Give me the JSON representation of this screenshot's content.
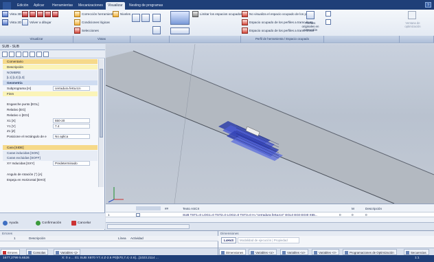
{
  "menu": {
    "tabs": [
      "Edición",
      "Aplicar",
      "Herramientas",
      "Mecanizaciones",
      "Visualizar",
      "Nesting de programas"
    ],
    "active": "Visualizar",
    "help_icon": "help-icon"
  },
  "ribbon": {
    "vista3d": "Vista 3D",
    "vista2d": "Vista 2D",
    "volver_dibujar": "Volver a dibujar",
    "correccion": "Corrección herramienta",
    "niveles": "Niveles",
    "condiciones": "Condiciones lógicas",
    "selecciones": "Selecciones",
    "limitar": "Limitar los espacios ocupados 3D",
    "no_visualiza": "No visualiza el espacio ocupado de los perfiles",
    "lleno": "Espacio ocupado de los perfiles a tramo lleno",
    "lineal": "Espacio ocupado de los perfiles a tramo lineal",
    "perfiles_originales": "Perfiles originales en corrección",
    "ventana_optim": "Ventana de optimización",
    "groups": [
      "Visualizar",
      "Vistas",
      "",
      "",
      "Perfil de herramienta / Espacio ocupado",
      "",
      ""
    ]
  },
  "left_panel": {
    "title": "SUB - SUB",
    "rows": [
      {
        "label": "Comentario",
        "style": "sel",
        "value": ""
      },
      {
        "label": "Descripción",
        "style": "yel",
        "value": ""
      },
      {
        "label": "NOMBRE",
        "style": "hdr",
        "value": ""
      },
      {
        "label": "[L1] [L2] [L3]",
        "style": "hdr",
        "value": ""
      },
      {
        "label": "Geometría",
        "style": "sect",
        "value": ""
      },
      {
        "label": "Subprograma [H]",
        "style": "",
        "value": "cerradura ferta.tcn"
      },
      {
        "label": "Finm",
        "style": "yel",
        "value": ""
      },
      {
        "label": "",
        "style": "",
        "value": ""
      },
      {
        "label": "Enganche punto [EGL]",
        "style": "",
        "value": ""
      },
      {
        "label": "Relativo [EG]",
        "style": "",
        "value": ""
      },
      {
        "label": "Relativo o [EGI]",
        "style": "",
        "value": ""
      },
      {
        "label": "X1 [X]",
        "style": "",
        "value": "550-20"
      },
      {
        "label": "Y1 [Y]",
        "style": "",
        "value": "7.4"
      },
      {
        "label": "Z1 [Z]",
        "style": "",
        "value": ""
      },
      {
        "label": "Posicione el rectángulo de e",
        "style": "",
        "value": "No aplica"
      },
      {
        "label": "",
        "style": "",
        "value": ""
      },
      {
        "label": "Cara [SIDE]",
        "style": "sel",
        "value": ""
      },
      {
        "label": "Caras inducidas [SON]",
        "style": "hdr",
        "value": ""
      },
      {
        "label": "Caras excluidas [SOFF]",
        "style": "hdr",
        "value": ""
      },
      {
        "label": "XY Inducidas [SXY]",
        "style": "",
        "value": "Predeterminado"
      },
      {
        "label": "",
        "style": "",
        "value": ""
      },
      {
        "label": "Angulo de rotación (°) [A]",
        "style": "",
        "value": ""
      },
      {
        "label": "Espeja en Horizontal [EHO]",
        "style": "",
        "value": ""
      }
    ],
    "buttons": {
      "help": "Ayuda",
      "confirm": "Confirmación",
      "cancel": "Cancelar"
    }
  },
  "bottom_table": {
    "cols": {
      "text": "Texto ASCII",
      "m": "M",
      "desc": "Descripción"
    },
    "row": {
      "num": "1",
      "text": "SUB TST1=0 LOG1=0 TST2=0 LOG2=0 TST3=0 H=\"cerradura ferta.tcn\" EGL0 EG0 EGI0 X55...",
      "c1": "0",
      "c2": "0",
      "c3": "0"
    }
  },
  "errors_panel": {
    "header": "Errores",
    "col_num": "1",
    "col_desc": "Descripción",
    "col_line": "Línea",
    "col_act": "Actividad",
    "tabs": [
      "Errores",
      "Consolas",
      "Variables <j>"
    ]
  },
  "dims_panel": {
    "header": "Dimensiones",
    "mode_label": "Modalidad de ejecución",
    "mode_value": "Propiedad",
    "mode_btn": "LxHxS",
    "tabs": [
      "Dimensiones",
      "Variables <o>",
      "Variables <v>",
      "Variables <r>",
      "Programaciones de Optimización",
      "Secuencias"
    ]
  },
  "status": {
    "coords": "1677,2799 5.6526",
    "info": "X: 0 ± ... E1 SUB X870 Y7.4 Z-2.6 P0[570,7.4;-2.6]...[1023.2114 ...",
    "zoom": "1:1"
  }
}
